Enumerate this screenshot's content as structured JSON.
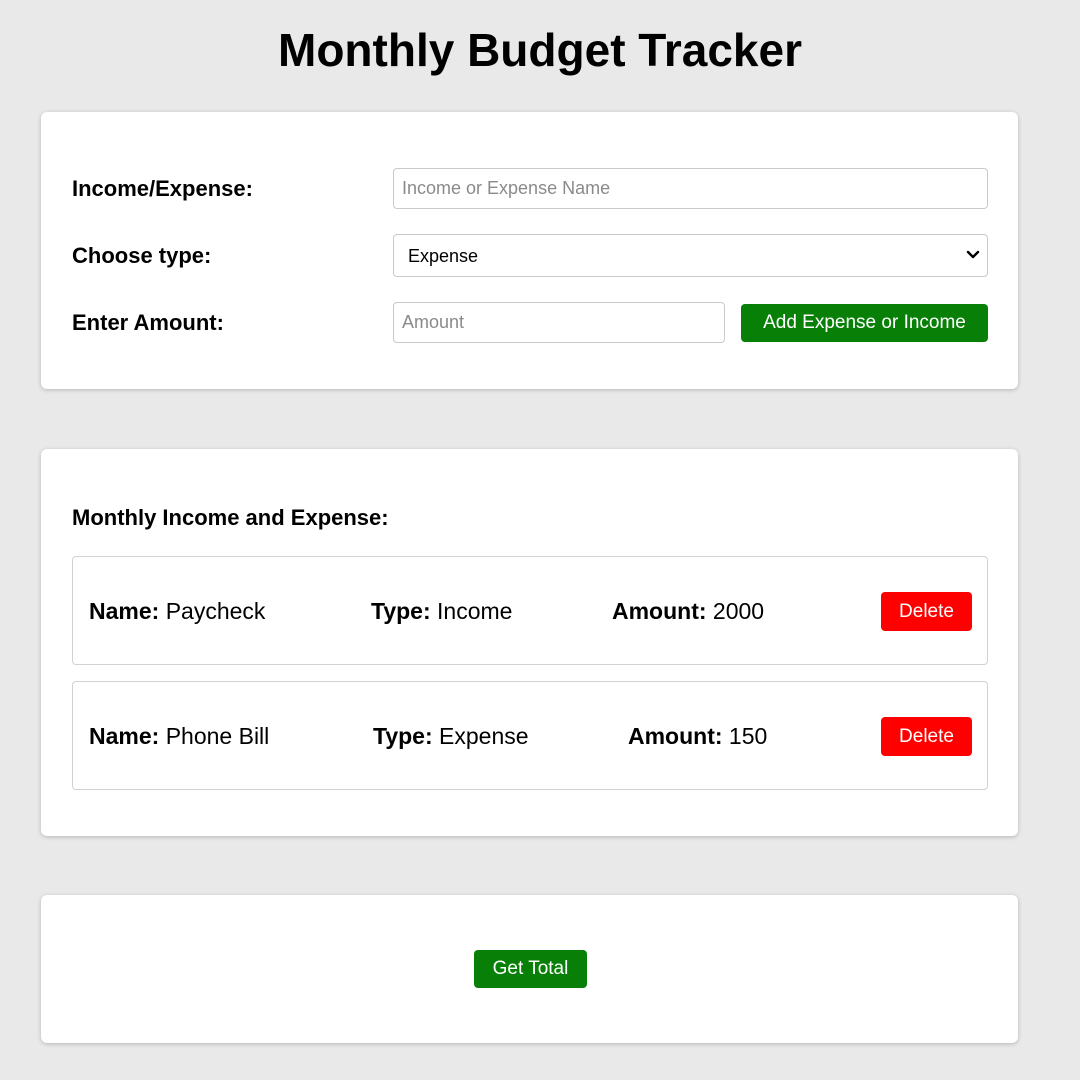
{
  "page": {
    "title": "Monthly Budget Tracker"
  },
  "form": {
    "name_label": "Income/Expense:",
    "name_placeholder": "Income or Expense Name",
    "name_value": "",
    "type_label": "Choose type:",
    "type_selected": "Expense",
    "amount_label": "Enter Amount:",
    "amount_placeholder": "Amount",
    "amount_value": "",
    "add_button_label": "Add Expense or Income"
  },
  "list": {
    "heading": "Monthly Income and Expense:",
    "name_key": "Name:",
    "type_key": "Type:",
    "amount_key": "Amount:",
    "delete_label": "Delete",
    "entries": [
      {
        "name": "Paycheck",
        "type": "Income",
        "amount": "2000"
      },
      {
        "name": "Phone Bill",
        "type": "Expense",
        "amount": "150"
      }
    ]
  },
  "total": {
    "button_label": "Get Total"
  },
  "colors": {
    "background": "#e9e9e9",
    "primary_green": "#088008",
    "delete_red": "#ff0000"
  },
  "icons": {
    "select_arrow": "chevron-down-icon"
  }
}
